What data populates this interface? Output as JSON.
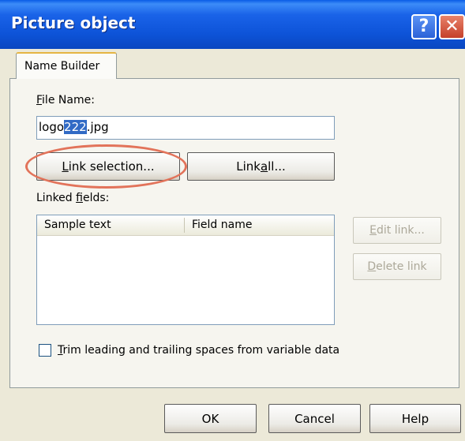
{
  "window": {
    "title": "Picture object",
    "help_glyph": "?",
    "close_glyph": "✕"
  },
  "tabs": [
    {
      "label": "Name Builder",
      "active": true
    }
  ],
  "file_name": {
    "label_first": "F",
    "label_rest": "ile Name:",
    "value_before": "logo",
    "value_selected": "222",
    "value_after": ".jpg"
  },
  "buttons": {
    "link_selection": {
      "u": "L",
      "rest": "ink selection..."
    },
    "link_all": {
      "pre": "Link ",
      "u": "a",
      "rest": "ll..."
    },
    "edit_link": {
      "u": "E",
      "rest": "dit link..."
    },
    "delete_link": {
      "u": "D",
      "rest": "elete link"
    },
    "ok": "OK",
    "cancel": "Cancel",
    "help": "Help"
  },
  "linked_fields": {
    "label_pre": "Linked ",
    "label_u": "f",
    "label_rest": "ields:",
    "columns": [
      "Sample text",
      "Field name"
    ],
    "rows": []
  },
  "trim_option": {
    "u": "T",
    "rest": "rim leading and trailing spaces from variable data",
    "checked": false
  },
  "colors": {
    "title_bar": "#0d53d8",
    "selection": "#316ac5",
    "highlight_ellipse": "#e2735a"
  }
}
